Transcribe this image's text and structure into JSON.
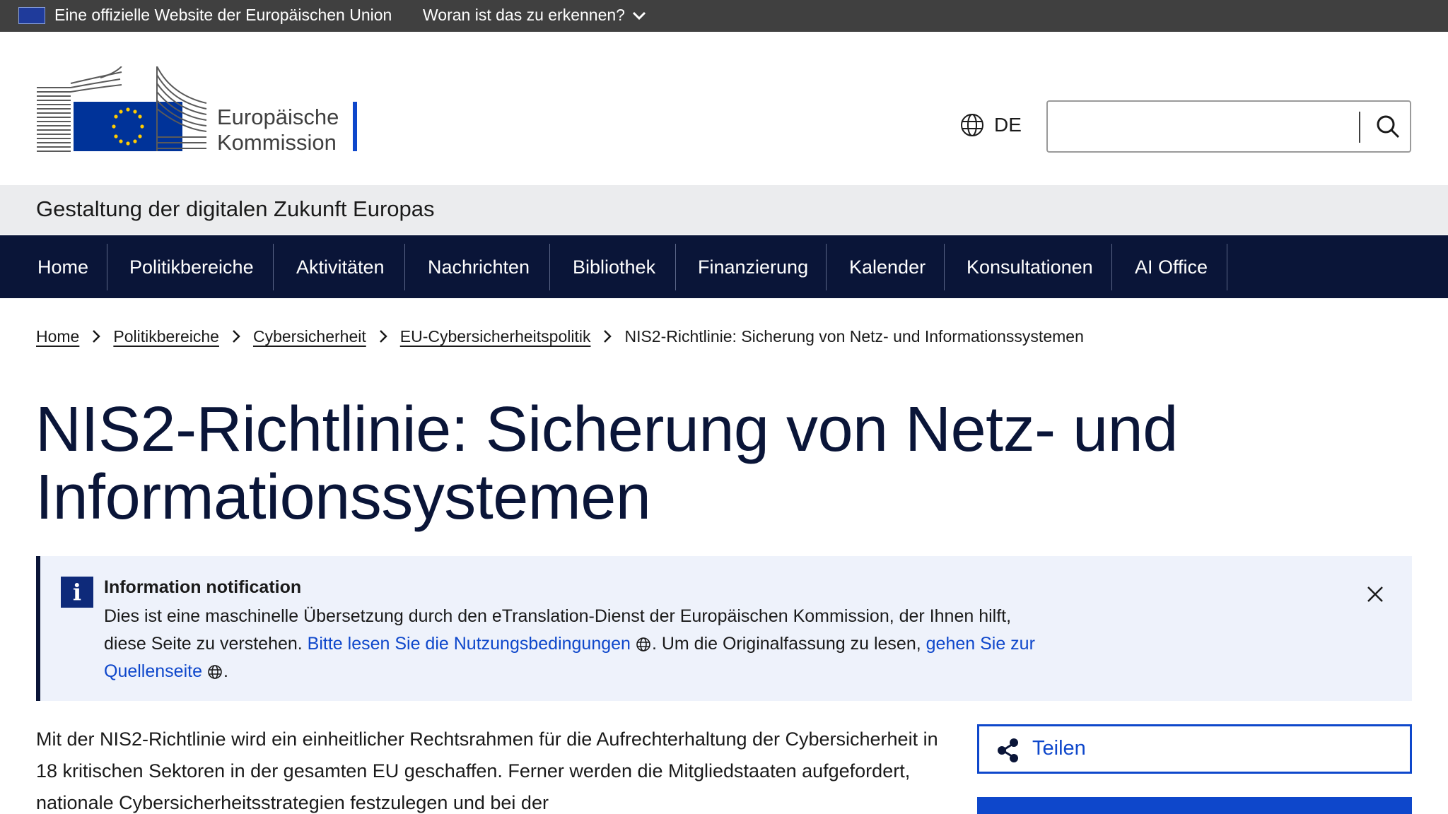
{
  "eu_banner": {
    "official_text": "Eine offizielle Website der Europäischen Union",
    "how_text": "Woran ist das zu erkennen?"
  },
  "header": {
    "logo_line1": "Europäische",
    "logo_line2": "Kommission",
    "language": "DE",
    "search_value": ""
  },
  "site": {
    "name": "Gestaltung der digitalen Zukunft Europas"
  },
  "nav": {
    "items": [
      "Home",
      "Politikbereiche",
      "Aktivitäten",
      "Nachrichten",
      "Bibliothek",
      "Finanzierung",
      "Kalender",
      "Konsultationen",
      "AI Office"
    ]
  },
  "breadcrumb": {
    "items": [
      "Home",
      "Politikbereiche",
      "Cybersicherheit",
      "EU-Cybersicherheitspolitik"
    ],
    "current": "NIS2-Richtlinie: Sicherung von Netz- und Informationssystemen"
  },
  "page": {
    "title_line1": "NIS2-Richtlinie: Sicherung von Netz- und",
    "title_line2": "Informationssystemen"
  },
  "notification": {
    "title": "Information notification",
    "text1": "Dies ist eine maschinelle Übersetzung durch den eTranslation-Dienst der Europäischen Kommission, der Ihnen hilft, diese Seite zu verstehen. ",
    "link1": "Bitte lesen Sie die Nutzungsbedingungen",
    "text2": ". Um die Originalfassung zu lesen, ",
    "link2": "gehen Sie zur Quellenseite",
    "text3": "."
  },
  "body": {
    "paragraph": "Mit der NIS2-Richtlinie wird ein einheitlicher Rechtsrahmen für die Aufrechterhaltung der Cybersicherheit in 18 kritischen Sektoren in der gesamten EU geschaffen. Ferner werden die Mitgliedstaaten aufgefordert, nationale Cybersicherheitsstrategien festzulegen und bei der"
  },
  "share": {
    "label": "Teilen"
  },
  "colors": {
    "primary_blue": "#0e47cb",
    "nav_dark": "#0a1538",
    "banner_grey": "#404040",
    "eu_flag_blue": "#003399",
    "eu_star_yellow": "#ffcc00"
  }
}
